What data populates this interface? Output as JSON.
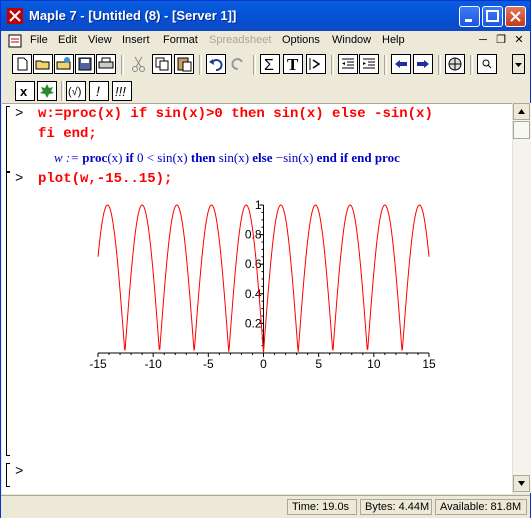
{
  "window": {
    "title": "Maple 7  - [Untitled (8) - [Server 1]]"
  },
  "menu": [
    "File",
    "Edit",
    "View",
    "Insert",
    "Format",
    "Spreadsheet",
    "Options",
    "Window",
    "Help"
  ],
  "menu_disabled": [
    "Spreadsheet"
  ],
  "worksheet": {
    "prompt": ">",
    "input1_line1": "w:=proc(x) if sin(x)>0 then sin(x) else -sin(x)",
    "input1_line2": "fi end;",
    "output1_prefix": "w := ",
    "output1_kw1": "proc",
    "output1_mid1": "(x) ",
    "output1_kw2": "if",
    "output1_mid2": " 0 < sin(x) ",
    "output1_kw3": "then",
    "output1_mid3": " sin(x) ",
    "output1_kw4": "else",
    "output1_mid4": " −sin(x) ",
    "output1_kw5": "end if end proc",
    "input2": "plot(w,-15..15);",
    "empty_prompt": ">"
  },
  "chart_data": {
    "type": "line",
    "function": "abs(sin(x))",
    "xlim": [
      -15,
      15
    ],
    "ylim": [
      0,
      1
    ],
    "x_ticks": [
      "-15",
      "-10",
      "-5",
      "0",
      "5",
      "10",
      "15"
    ],
    "y_ticks": [
      "0.2",
      "0.4",
      "0.6",
      "0.8",
      "1"
    ],
    "series": [
      {
        "color": "#ff0000"
      }
    ]
  },
  "status": {
    "time": "Time:  19.0s",
    "bytes": "Bytes: 4.44M",
    "available": "Available: 81.8M"
  },
  "colors": {
    "input": "#ff0000",
    "output": "#0000c8",
    "plot": "#ff0000",
    "titlebar": "#0453d8"
  }
}
